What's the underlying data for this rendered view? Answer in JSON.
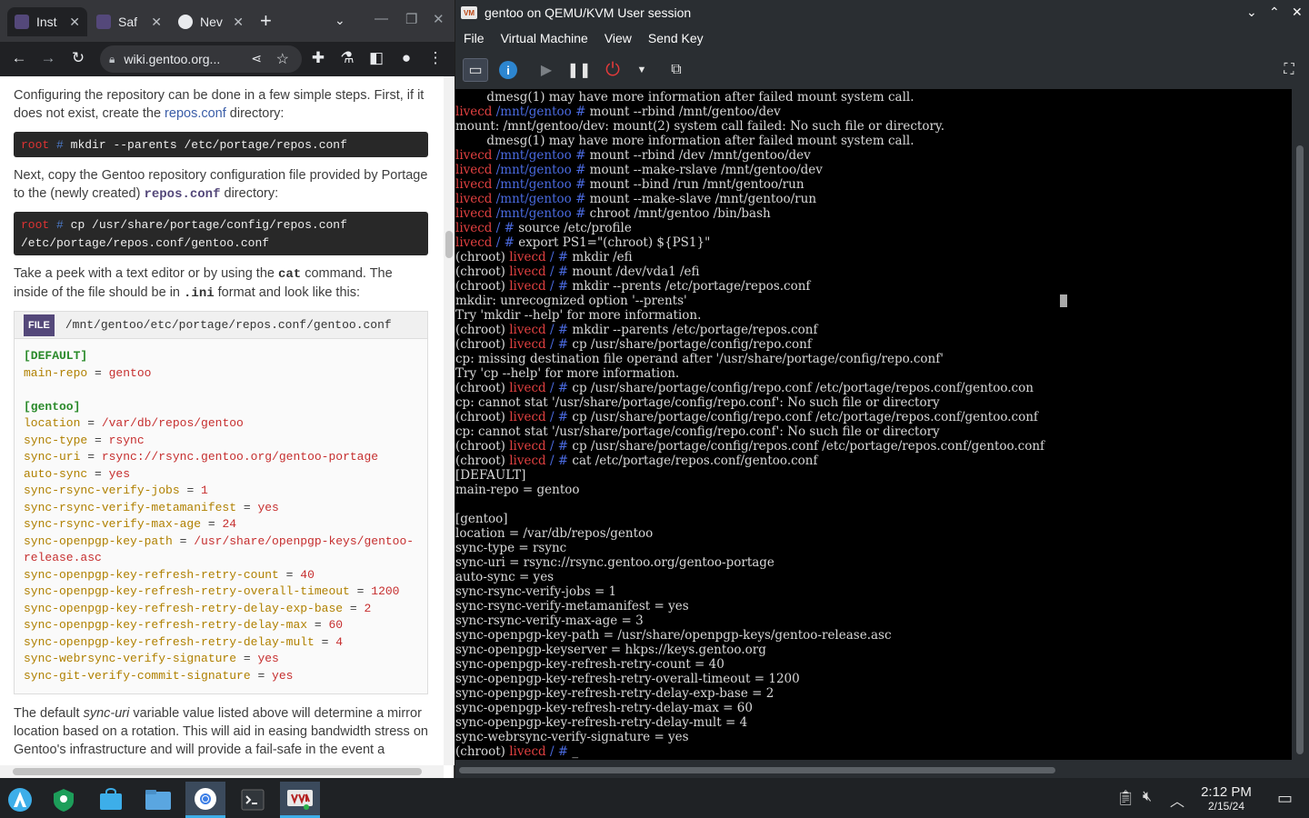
{
  "browser": {
    "tabs": [
      {
        "label": "Inst",
        "icon": "gentoo-icon"
      },
      {
        "label": "Saf",
        "icon": "gentoo-icon"
      },
      {
        "label": "Nev",
        "icon": "chrome-icon"
      }
    ],
    "url": "wiki.gentoo.org...",
    "content": {
      "p1_pre": "Configuring the repository can be done in a few simple steps. First, if it does not exist, create the ",
      "p1_link": "repos.conf",
      "p1_post": " directory:",
      "cmd1_prompt": "root",
      "cmd1_hash": "#",
      "cmd1_text": " mkdir --parents /etc/portage/repos.conf",
      "p2_pre": "Next, copy the Gentoo repository configuration file provided by Portage to the (newly created) ",
      "p2_code": "repos.conf",
      "p2_post": " directory:",
      "cmd2_prompt": "root",
      "cmd2_hash": "#",
      "cmd2_line1": " cp /usr/share/portage/config/repos.conf",
      "cmd2_line2": "/etc/portage/repos.conf/gentoo.conf",
      "p3_pre": "Take a peek with a text editor or by using the ",
      "p3_code1": "cat",
      "p3_mid": " command. The inside of the file should be in ",
      "p3_code2": ".ini",
      "p3_post": " format and look like this:",
      "file_badge": "FILE",
      "file_path": "/mnt/gentoo/etc/portage/repos.conf/gentoo.conf",
      "file_lines": [
        {
          "section": "[DEFAULT]"
        },
        {
          "key": "main-repo",
          "value": "gentoo"
        },
        {
          "blank": true
        },
        {
          "section": "[gentoo]"
        },
        {
          "key": "location",
          "value": "/var/db/repos/gentoo"
        },
        {
          "key": "sync-type",
          "value": "rsync"
        },
        {
          "key": "sync-uri",
          "value": "rsync://rsync.gentoo.org/gentoo-portage"
        },
        {
          "key": "auto-sync",
          "value": "yes"
        },
        {
          "key": "sync-rsync-verify-jobs",
          "value": "1"
        },
        {
          "key": "sync-rsync-verify-metamanifest",
          "value": "yes"
        },
        {
          "key": "sync-rsync-verify-max-age",
          "value": "24"
        },
        {
          "key": "sync-openpgp-key-path",
          "value": "/usr/share/openpgp-keys/gentoo-",
          "cont": "release.asc"
        },
        {
          "key": "sync-openpgp-key-refresh-retry-count",
          "value": "40"
        },
        {
          "key": "sync-openpgp-key-refresh-retry-overall-timeout",
          "value": "1200"
        },
        {
          "key": "sync-openpgp-key-refresh-retry-delay-exp-base",
          "value": "2"
        },
        {
          "key": "sync-openpgp-key-refresh-retry-delay-max",
          "value": "60"
        },
        {
          "key": "sync-openpgp-key-refresh-retry-delay-mult",
          "value": "4"
        },
        {
          "key": "sync-webrsync-verify-signature",
          "value": "yes"
        },
        {
          "key": "sync-git-verify-commit-signature",
          "value": "yes"
        }
      ],
      "p4_pre": "The default ",
      "p4_em": "sync-uri",
      "p4_post": " variable value listed above will determine a mirror location based on a rotation. This will aid in easing bandwidth stress on Gentoo's infrastructure and will provide a fail-safe in the event a"
    }
  },
  "vm": {
    "title": "gentoo on QEMU/KVM User session",
    "app_badge": "VM",
    "menu": [
      "File",
      "Virtual Machine",
      "View",
      "Send Key"
    ],
    "terminal": [
      [
        {
          "t": "        dmesg(1) may have more information after failed mount system call."
        }
      ],
      [
        {
          "c": "r",
          "t": "livecd "
        },
        {
          "c": "b",
          "t": "/mnt/gentoo # "
        },
        {
          "t": "mount --rbind /mnt/gentoo/dev"
        }
      ],
      [
        {
          "t": "mount: /mnt/gentoo/dev: mount(2) system call failed: No such file or directory."
        }
      ],
      [
        {
          "t": "        dmesg(1) may have more information after failed mount system call."
        }
      ],
      [
        {
          "c": "r",
          "t": "livecd "
        },
        {
          "c": "b",
          "t": "/mnt/gentoo # "
        },
        {
          "t": "mount --rbind /dev /mnt/gentoo/dev"
        }
      ],
      [
        {
          "c": "r",
          "t": "livecd "
        },
        {
          "c": "b",
          "t": "/mnt/gentoo # "
        },
        {
          "t": "mount --make-rslave /mnt/gentoo/dev"
        }
      ],
      [
        {
          "c": "r",
          "t": "livecd "
        },
        {
          "c": "b",
          "t": "/mnt/gentoo # "
        },
        {
          "t": "mount --bind /run /mnt/gentoo/run"
        }
      ],
      [
        {
          "c": "r",
          "t": "livecd "
        },
        {
          "c": "b",
          "t": "/mnt/gentoo # "
        },
        {
          "t": "mount --make-slave /mnt/gentoo/run"
        }
      ],
      [
        {
          "c": "r",
          "t": "livecd "
        },
        {
          "c": "b",
          "t": "/mnt/gentoo # "
        },
        {
          "t": "chroot /mnt/gentoo /bin/bash"
        }
      ],
      [
        {
          "c": "r",
          "t": "livecd "
        },
        {
          "c": "b",
          "t": "/ # "
        },
        {
          "t": "source /etc/profile"
        }
      ],
      [
        {
          "c": "r",
          "t": "livecd "
        },
        {
          "c": "b",
          "t": "/ # "
        },
        {
          "t": "export PS1=\"(chroot) ${PS1}\""
        }
      ],
      [
        {
          "t": "(chroot) "
        },
        {
          "c": "r",
          "t": "livecd "
        },
        {
          "c": "b",
          "t": "/ # "
        },
        {
          "t": "mkdir /efi"
        }
      ],
      [
        {
          "t": "(chroot) "
        },
        {
          "c": "r",
          "t": "livecd "
        },
        {
          "c": "b",
          "t": "/ # "
        },
        {
          "t": "mount /dev/vda1 /efi"
        }
      ],
      [
        {
          "t": "(chroot) "
        },
        {
          "c": "r",
          "t": "livecd "
        },
        {
          "c": "b",
          "t": "/ # "
        },
        {
          "t": "mkdir --prents /etc/portage/repos.conf"
        }
      ],
      [
        {
          "t": "mkdir: unrecognized option '--prents'"
        }
      ],
      [
        {
          "t": "Try 'mkdir --help' for more information."
        }
      ],
      [
        {
          "t": "(chroot) "
        },
        {
          "c": "r",
          "t": "livecd "
        },
        {
          "c": "b",
          "t": "/ # "
        },
        {
          "t": "mkdir --parents /etc/portage/repos.conf"
        }
      ],
      [
        {
          "t": "(chroot) "
        },
        {
          "c": "r",
          "t": "livecd "
        },
        {
          "c": "b",
          "t": "/ # "
        },
        {
          "t": "cp /usr/share/portage/config/repo.conf"
        }
      ],
      [
        {
          "t": "cp: missing destination file operand after '/usr/share/portage/config/repo.conf'"
        }
      ],
      [
        {
          "t": "Try 'cp --help' for more information."
        }
      ],
      [
        {
          "t": "(chroot) "
        },
        {
          "c": "r",
          "t": "livecd "
        },
        {
          "c": "b",
          "t": "/ # "
        },
        {
          "t": "cp /usr/share/portage/config/repo.conf /etc/portage/repos.conf/gentoo.con"
        }
      ],
      [
        {
          "t": "cp: cannot stat '/usr/share/portage/config/repo.conf': No such file or directory"
        }
      ],
      [
        {
          "t": "(chroot) "
        },
        {
          "c": "r",
          "t": "livecd "
        },
        {
          "c": "b",
          "t": "/ # "
        },
        {
          "t": "cp /usr/share/portage/config/repo.conf /etc/portage/repos.conf/gentoo.conf"
        }
      ],
      [
        {
          "t": "cp: cannot stat '/usr/share/portage/config/repo.conf': No such file or directory"
        }
      ],
      [
        {
          "t": "(chroot) "
        },
        {
          "c": "r",
          "t": "livecd "
        },
        {
          "c": "b",
          "t": "/ # "
        },
        {
          "t": "cp /usr/share/portage/config/repos.conf /etc/portage/repos.conf/gentoo.conf"
        }
      ],
      [
        {
          "t": "(chroot) "
        },
        {
          "c": "r",
          "t": "livecd "
        },
        {
          "c": "b",
          "t": "/ # "
        },
        {
          "t": "cat /etc/portage/repos.conf/gentoo.conf"
        }
      ],
      [
        {
          "t": "[DEFAULT]"
        }
      ],
      [
        {
          "t": "main-repo = gentoo"
        }
      ],
      [
        {
          "t": ""
        }
      ],
      [
        {
          "t": "[gentoo]"
        }
      ],
      [
        {
          "t": "location = /var/db/repos/gentoo"
        }
      ],
      [
        {
          "t": "sync-type = rsync"
        }
      ],
      [
        {
          "t": "sync-uri = rsync://rsync.gentoo.org/gentoo-portage"
        }
      ],
      [
        {
          "t": "auto-sync = yes"
        }
      ],
      [
        {
          "t": "sync-rsync-verify-jobs = 1"
        }
      ],
      [
        {
          "t": "sync-rsync-verify-metamanifest = yes"
        }
      ],
      [
        {
          "t": "sync-rsync-verify-max-age = 3"
        }
      ],
      [
        {
          "t": "sync-openpgp-key-path = /usr/share/openpgp-keys/gentoo-release.asc"
        }
      ],
      [
        {
          "t": "sync-openpgp-keyserver = hkps://keys.gentoo.org"
        }
      ],
      [
        {
          "t": "sync-openpgp-key-refresh-retry-count = 40"
        }
      ],
      [
        {
          "t": "sync-openpgp-key-refresh-retry-overall-timeout = 1200"
        }
      ],
      [
        {
          "t": "sync-openpgp-key-refresh-retry-delay-exp-base = 2"
        }
      ],
      [
        {
          "t": "sync-openpgp-key-refresh-retry-delay-max = 60"
        }
      ],
      [
        {
          "t": "sync-openpgp-key-refresh-retry-delay-mult = 4"
        }
      ],
      [
        {
          "t": "sync-webrsync-verify-signature = yes"
        }
      ],
      [
        {
          "t": "(chroot) "
        },
        {
          "c": "r",
          "t": "livecd "
        },
        {
          "c": "b",
          "t": "/ # "
        },
        {
          "t": "_"
        }
      ]
    ]
  },
  "taskbar": {
    "time": "2:12 PM",
    "date": "2/15/24"
  },
  "colors": {
    "accent": "#3daee9",
    "prompt_host": "#e04040",
    "prompt_path": "#4a6ae0",
    "link": "#3b5ea8"
  }
}
